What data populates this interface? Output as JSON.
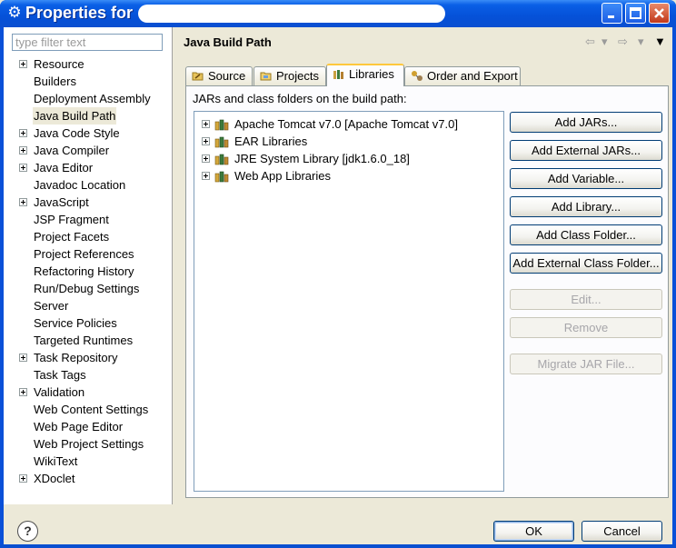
{
  "window": {
    "title": "Properties for",
    "accent": "#0a50d8"
  },
  "filter": {
    "placeholder": "type filter text",
    "value": ""
  },
  "tree": {
    "items": [
      {
        "label": "Resource",
        "expandable": true
      },
      {
        "label": "Builders",
        "expandable": false
      },
      {
        "label": "Deployment Assembly",
        "expandable": false
      },
      {
        "label": "Java Build Path",
        "expandable": false,
        "selected": true
      },
      {
        "label": "Java Code Style",
        "expandable": true
      },
      {
        "label": "Java Compiler",
        "expandable": true
      },
      {
        "label": "Java Editor",
        "expandable": true
      },
      {
        "label": "Javadoc Location",
        "expandable": false
      },
      {
        "label": "JavaScript",
        "expandable": true
      },
      {
        "label": "JSP Fragment",
        "expandable": false
      },
      {
        "label": "Project Facets",
        "expandable": false
      },
      {
        "label": "Project References",
        "expandable": false
      },
      {
        "label": "Refactoring History",
        "expandable": false
      },
      {
        "label": "Run/Debug Settings",
        "expandable": false
      },
      {
        "label": "Server",
        "expandable": false
      },
      {
        "label": "Service Policies",
        "expandable": false
      },
      {
        "label": "Targeted Runtimes",
        "expandable": false
      },
      {
        "label": "Task Repository",
        "expandable": true
      },
      {
        "label": "Task Tags",
        "expandable": false
      },
      {
        "label": "Validation",
        "expandable": true
      },
      {
        "label": "Web Content Settings",
        "expandable": false
      },
      {
        "label": "Web Page Editor",
        "expandable": false
      },
      {
        "label": "Web Project Settings",
        "expandable": false
      },
      {
        "label": "WikiText",
        "expandable": false
      },
      {
        "label": "XDoclet",
        "expandable": true
      }
    ]
  },
  "page": {
    "title": "Java Build Path",
    "tabs": [
      {
        "label": "Source",
        "icon": "source-folder-icon"
      },
      {
        "label": "Projects",
        "icon": "projects-icon"
      },
      {
        "label": "Libraries",
        "icon": "libraries-icon",
        "active": true
      },
      {
        "label": "Order and Export",
        "icon": "order-export-icon"
      }
    ],
    "caption": "JARs and class folders on the build path:",
    "libraries": [
      {
        "label": "Apache Tomcat v7.0 [Apache Tomcat v7.0]"
      },
      {
        "label": "EAR Libraries"
      },
      {
        "label": "JRE System Library [jdk1.6.0_18]"
      },
      {
        "label": "Web App Libraries"
      }
    ],
    "buttons": {
      "add_jars": "Add JARs...",
      "add_external_jars": "Add External JARs...",
      "add_variable": "Add Variable...",
      "add_library": "Add Library...",
      "add_class_folder": "Add Class Folder...",
      "add_external_class_folder": "Add External Class Folder...",
      "edit": "Edit...",
      "remove": "Remove",
      "migrate_jar": "Migrate JAR File..."
    }
  },
  "footer": {
    "help": "?",
    "ok": "OK",
    "cancel": "Cancel"
  }
}
